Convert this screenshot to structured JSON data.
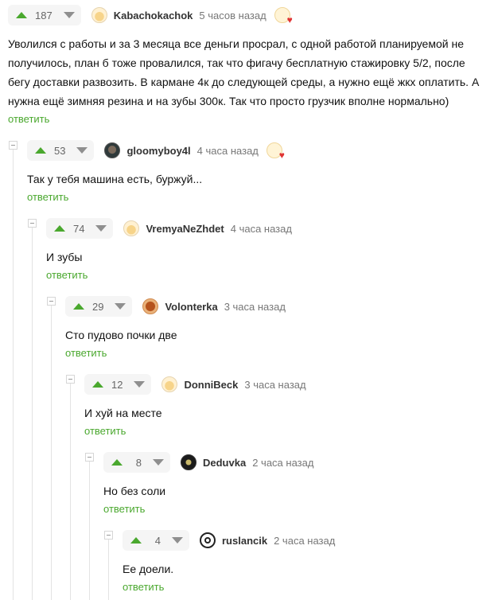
{
  "comments": [
    {
      "score": "187",
      "username": "Kabachokachok",
      "time": "5 часов назад",
      "text": "Уволился с работы и за 3 месяца все деньги просрал, с одной работой планируемой не получилось, план б тоже провалился, так что фигачу бесплатную стажировку 5/2, после бегу доставки развозить. В кармане 4к до следующей среды, а нужно ещё жкх оплатить. А нужна ещё зимняя резина и на зубы 300к. Так что просто грузчик вполне нормально)",
      "reply": "ответить"
    },
    {
      "score": "53",
      "username": "gloomyboy4l",
      "time": "4 часа назад",
      "text": "Так у тебя машина есть, буржуй...",
      "reply": "ответить"
    },
    {
      "score": "74",
      "username": "VremyaNeZhdet",
      "time": "4 часа назад",
      "text": "И зубы",
      "reply": "ответить"
    },
    {
      "score": "29",
      "username": "Volonterka",
      "time": "3 часа назад",
      "text": "Сто пудово почки две",
      "reply": "ответить"
    },
    {
      "score": "12",
      "username": "DonniBeck",
      "time": "3 часа назад",
      "text": "И хуй на месте",
      "reply": "ответить"
    },
    {
      "score": "8",
      "username": "Deduvka",
      "time": "2 часа назад",
      "text": "Но без соли",
      "reply": "ответить"
    },
    {
      "score": "4",
      "username": "ruslancik",
      "time": "2 часа назад",
      "text": "Ее доели.",
      "reply": "ответить"
    }
  ],
  "icons": {
    "upvote": "arrow-up-icon",
    "downvote": "arrow-down-icon",
    "collapse": "collapse-minus-icon",
    "award": "cake-heart-award-icon"
  },
  "colors": {
    "accent_green": "#4aa82e",
    "heart_red": "#e03333",
    "thread_line": "#e3e3e3"
  }
}
